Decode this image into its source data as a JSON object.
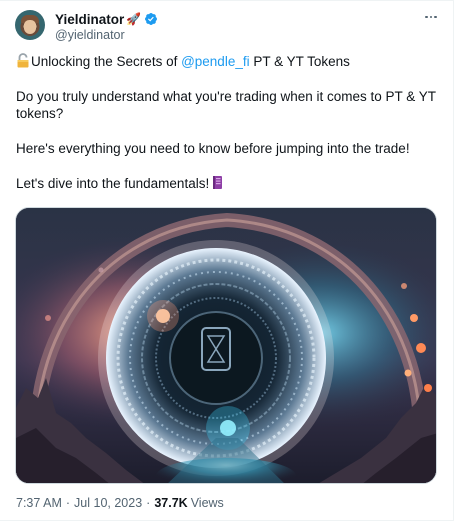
{
  "tweet": {
    "author": {
      "display_name": "Yieldinator",
      "emoji": "🚀",
      "handle": "@yieldinator",
      "verified": true
    },
    "text": {
      "line1_prefix": "Unlocking the Secrets of ",
      "line1_mention": "@pendle_fi",
      "line1_suffix": " PT & YT Tokens",
      "paragraph2": "Do you truly understand what you're trading when it comes to PT & YT tokens?",
      "paragraph3": "Here's everything you need to know before jumping into the trade!",
      "paragraph4": "Let's dive into the fundamentals!"
    },
    "meta": {
      "time": "7:37 AM",
      "date": "Jul 10, 2023",
      "separator": "·",
      "views_count": "37.7K",
      "views_label": "Views"
    },
    "icons": {
      "more": "more-options-icon",
      "verified": "verified-badge-icon",
      "lock": "lock-icon",
      "book": "book-icon"
    },
    "colors": {
      "link": "#1d9bf0",
      "secondary_text": "#536471",
      "verified": "#1d9bf0"
    }
  }
}
